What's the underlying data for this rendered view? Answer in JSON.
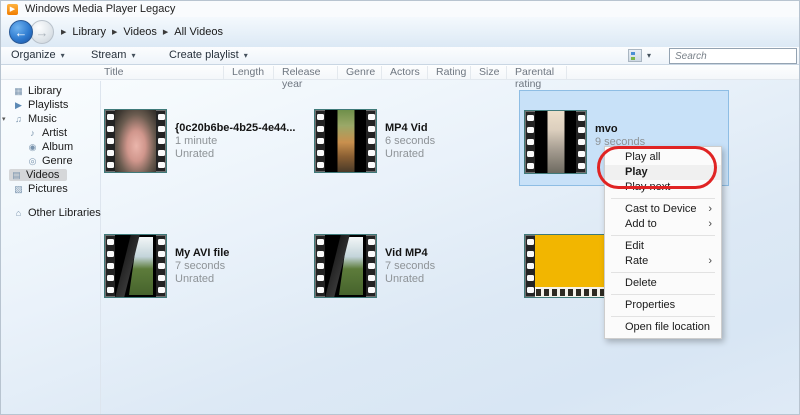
{
  "titlebar": {
    "title": "Windows Media Player Legacy"
  },
  "navbar": {
    "breadcrumb": [
      "Library",
      "Videos",
      "All Videos"
    ]
  },
  "toolbar": {
    "organize": "Organize",
    "stream": "Stream",
    "create_playlist": "Create playlist",
    "search_placeholder": "Search"
  },
  "list_header": {
    "columns": [
      "Title",
      "Length",
      "Release year",
      "Genre",
      "Actors",
      "Rating",
      "Size",
      "Parental rating"
    ]
  },
  "sidebar": {
    "items": [
      {
        "label": "Library",
        "glyph": "▦"
      },
      {
        "label": "Playlists",
        "glyph": "▶"
      },
      {
        "label": "Music",
        "glyph": "♫"
      },
      {
        "label": "Artist",
        "glyph": "♪"
      },
      {
        "label": "Album",
        "glyph": "◉"
      },
      {
        "label": "Genre",
        "glyph": "◎"
      },
      {
        "label": "Videos",
        "glyph": "▤"
      },
      {
        "label": "Pictures",
        "glyph": "▧"
      },
      {
        "label": "Other Libraries",
        "glyph": "⌂"
      }
    ]
  },
  "videos": [
    {
      "title": "{0c20b6be-4b25-4e44...",
      "length": "1 minute",
      "rating": "Unrated"
    },
    {
      "title": "MP4 Vid",
      "length": "6 seconds",
      "rating": "Unrated"
    },
    {
      "title": "mvo",
      "length": "9 seconds",
      "rating": ""
    },
    {
      "title": "My AVI file",
      "length": "7 seconds",
      "rating": "Unrated"
    },
    {
      "title": "Vid MP4",
      "length": "7 seconds",
      "rating": "Unrated"
    },
    {
      "title": "",
      "length": "",
      "rating": ""
    }
  ],
  "context_menu": {
    "items": [
      "Play all",
      "Play",
      "Play next",
      "Cast to Device",
      "Add to",
      "Edit",
      "Rate",
      "Delete",
      "Properties",
      "Open file location"
    ]
  },
  "icons": {
    "play_badge": "▶",
    "back_arrow": "←",
    "forward_arrow": "→",
    "breadcrumb_arrow": "▶",
    "dropdown_caret": "▾",
    "expand_chevron": "▾"
  },
  "colors": {
    "selection_fill": "#c8e1f8",
    "selection_border": "#8ebde4",
    "annotation_red": "#e02424",
    "filmstrip_teal": "#3f7a7a",
    "thumb_yellow": "#f2b600"
  }
}
